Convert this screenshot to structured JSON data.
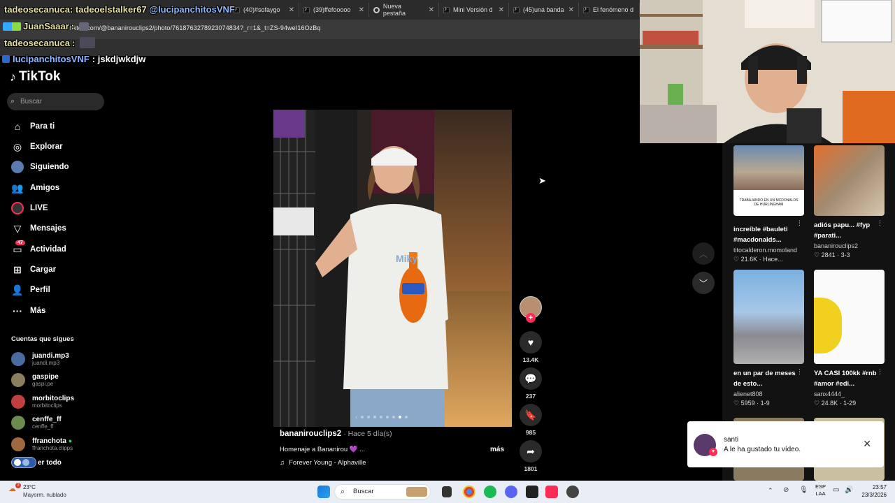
{
  "tabs": [
    {
      "label": "(40)#sofaygo",
      "icon": "tiktok-icon"
    },
    {
      "label": "(39)ffefooooo",
      "icon": "tiktok-icon"
    },
    {
      "label": "Nueva pestaña",
      "icon": "chrome-icon"
    },
    {
      "label": "Mini Versión d",
      "icon": "tiktok-icon"
    },
    {
      "label": "(45)una banda",
      "icon": "tiktok-icon"
    },
    {
      "label": "El fenómeno d",
      "icon": "tiktok-icon"
    }
  ],
  "url": "tiktok.com/@bananirouclips2/photo/7618763278923074834?_r=1&_t=ZS-94weI16OzBq",
  "chat": [
    {
      "user": "tadeosecanuca",
      "text": ": tadeoelstalker67 ",
      "mention": "@lucipanchitosVNF"
    },
    {
      "user": "JuanSaaar",
      "text": ":",
      "mention": ""
    },
    {
      "user": "tadeosecanuca",
      "text": ":",
      "mention": ""
    },
    {
      "user": "lucipanchitosVNF",
      "text": ": jskdjwkdjw",
      "mention": ""
    }
  ],
  "sidebar": {
    "logo": "TikTok",
    "search_placeholder": "Buscar",
    "items": [
      {
        "label": "Para ti",
        "icon": "home-icon"
      },
      {
        "label": "Explorar",
        "icon": "compass-icon"
      },
      {
        "label": "Siguiendo",
        "icon": "following-icon"
      },
      {
        "label": "Amigos",
        "icon": "friends-icon"
      },
      {
        "label": "LIVE",
        "icon": "live-icon"
      },
      {
        "label": "Mensajes",
        "icon": "send-icon"
      },
      {
        "label": "Actividad",
        "icon": "activity-icon",
        "badge": "47"
      },
      {
        "label": "Cargar",
        "icon": "upload-icon"
      },
      {
        "label": "Perfil",
        "icon": "profile-icon"
      },
      {
        "label": "Más",
        "icon": "more-icon"
      }
    ],
    "following_title": "Cuentas que sigues",
    "accounts": [
      {
        "name": "juandi.mp3",
        "handle": "juandi.mp3",
        "color": "#4a6aa0"
      },
      {
        "name": "gaspipe",
        "handle": "gaspi.pe",
        "color": "#8a8060"
      },
      {
        "name": "morbitoclips",
        "handle": "morbitoclips",
        "color": "#c04040"
      },
      {
        "name": "cenffe_ff",
        "handle": "cenffe_ff",
        "color": "#6a8a50"
      },
      {
        "name": "ffranchota",
        "handle": "ffranchota.clipps",
        "color": "#a06a40",
        "verified": true
      }
    ],
    "see_all": "er todo"
  },
  "post": {
    "user": "bananirouclips2",
    "time": "· Hace 5 día(s)",
    "caption": "Homenaje a Bananirou 💜 ...",
    "more": "más",
    "music": "Forever Young - Alphaville",
    "likes": "13.4K",
    "comments": "237",
    "saves": "985",
    "shares": "1801",
    "slide": {
      "current": 7,
      "total": 8
    }
  },
  "recommended": [
    {
      "title": "increíble #bauleti #macdonalds...",
      "author": "titocalderon.momoland",
      "likes": "21.6K",
      "date": "Hace...",
      "thumb": "street",
      "caption_in_thumb": "TRABAJANDO EN UN MCDONALDS DE HURLINGHAM"
    },
    {
      "title": "adiós papu... #fyp #parati...",
      "author": "bananirouclips2",
      "likes": "2841",
      "date": "3-3",
      "thumb": "room"
    },
    {
      "title": "en un par de meses de esto...",
      "author": "alienet808",
      "likes": "5959",
      "date": "1-9",
      "thumb": "sky"
    },
    {
      "title": "YA CASI 100kk #rnb #amor #edi...",
      "author": "sanx4444_",
      "likes": "24.8K",
      "date": "1-29",
      "thumb": "yellow"
    }
  ],
  "toast": {
    "name": "santi",
    "message": "A le ha gustado tu vídeo."
  },
  "taskbar": {
    "weather_temp": "23°C",
    "weather_desc": "Mayorm. nublado",
    "weather_badge": "2",
    "search": "Buscar",
    "lang": "ESP",
    "lang2": "LAA",
    "time": "23:57",
    "date": "23/3/2026"
  }
}
